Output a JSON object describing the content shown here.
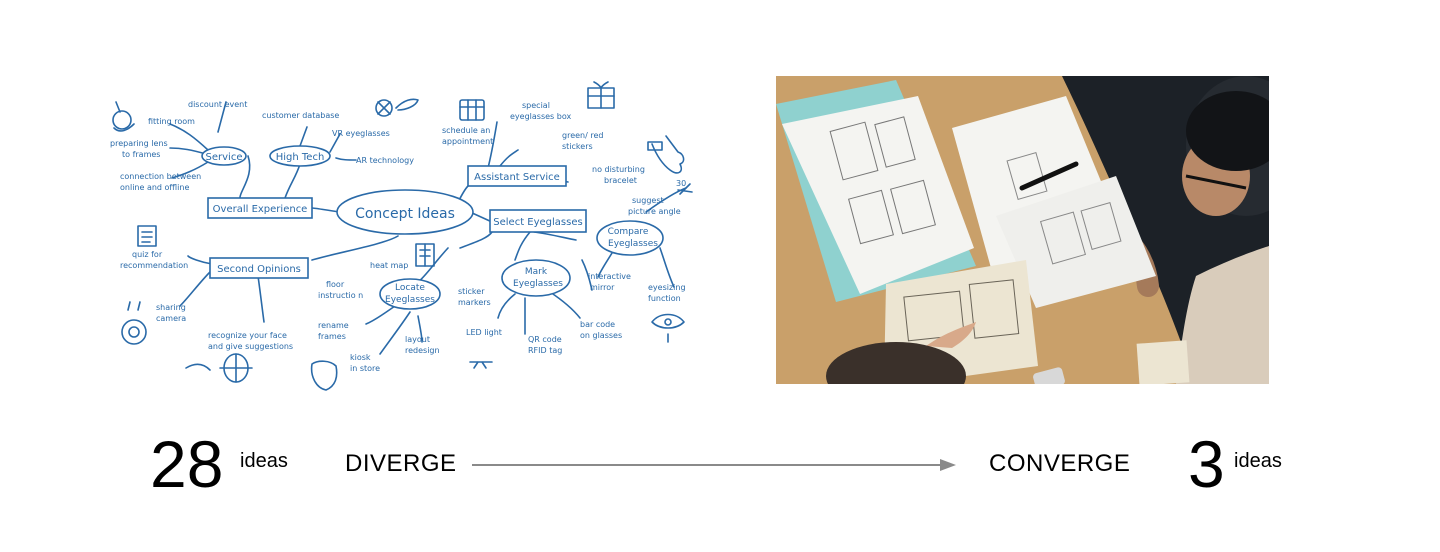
{
  "mindmap": {
    "center": "Concept Ideas",
    "nodes": {
      "service": "Service",
      "high_tech": "High Tech",
      "overall_experience": "Overall Experience",
      "assistant_service": "Assistant Service",
      "select_eyeglasses": "Select Eyeglasses",
      "compare_eyeglasses_1": "Compare",
      "compare_eyeglasses_2": "Eyeglasses",
      "mark_eyeglasses_1": "Mark",
      "mark_eyeglasses_2": "Eyeglasses",
      "locate_eyeglasses_1": "Locate",
      "locate_eyeglasses_2": "Eyeglasses",
      "second_opinions": "Second Opinions"
    },
    "leaves": {
      "discount_event": "discount event",
      "fitting_room": "fitting room",
      "preparing_lens_1": "preparing lens",
      "preparing_lens_2": "to frames",
      "connection_1": "connection between",
      "connection_2": "online and offline",
      "customer_database": "customer database",
      "vr_eyeglasses": "VR eyeglasses",
      "ar_technology": "AR technology",
      "schedule_1": "schedule an",
      "schedule_2": "appointment",
      "special_box_1": "special",
      "special_box_2": "eyeglasses box",
      "stickers_1": "green/ red",
      "stickers_2": "stickers",
      "bracelet_1": "no disturbing",
      "bracelet_2": "bracelet",
      "picture_angle_1": "suggest",
      "picture_angle_2": "picture angle",
      "interactive_mirror_1": "interactive",
      "interactive_mirror_2": "mirror",
      "eyesizing_1": "eyesizing",
      "eyesizing_2": "function",
      "sticker_markers_1": "sticker",
      "sticker_markers_2": "markers",
      "led_light": "LED light",
      "qr_code_1": "QR code",
      "qr_code_2": "RFID tag",
      "bar_code_1": "bar code",
      "bar_code_2": "on glasses",
      "heat_map": "heat map",
      "floor_instruction_1": "floor",
      "floor_instruction_2": "instructio n",
      "rename_frames_1": "rename",
      "rename_frames_2": "frames",
      "kiosk_1": "kiosk",
      "kiosk_2": "in store",
      "layout_redesign_1": "layout",
      "layout_redesign_2": "redesign",
      "quiz_1": "quiz for",
      "quiz_2": "recommendation",
      "sharing_camera_1": "sharing",
      "sharing_camera_2": "camera",
      "recognize_1": "recognize your face",
      "recognize_2": "and give suggestions",
      "tick_30": "30"
    }
  },
  "photo": {
    "colors": {
      "table": "#c9a06a",
      "paper": "#f4f4f1",
      "folder": "#8fd1cf",
      "shirt": "#1c2127"
    }
  },
  "summary": {
    "diverge_count": "28",
    "diverge_unit": "ideas",
    "diverge_label": "DIVERGE",
    "converge_label": "CONVERGE",
    "converge_count": "3",
    "converge_unit": "ideas"
  },
  "colors": {
    "ink": "#2a6aa8",
    "arrow": "#8a8a8a",
    "text": "#000000"
  }
}
